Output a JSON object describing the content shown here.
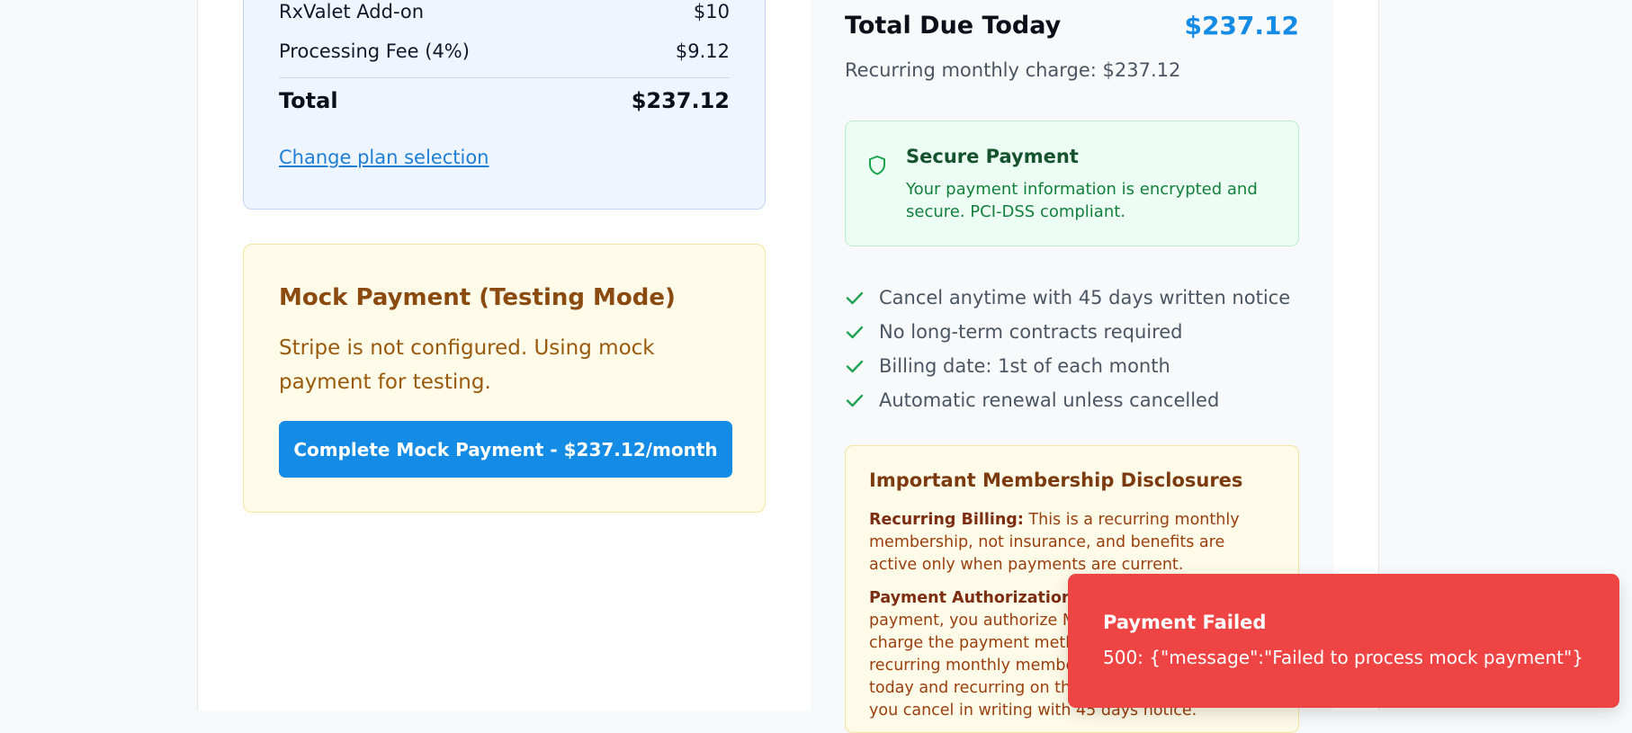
{
  "order_summary": {
    "addon_label": "RxValet Add-on",
    "addon_amount": "$10",
    "fee_label": "Processing Fee (4%)",
    "fee_amount": "$9.12",
    "total_label": "Total",
    "total_amount": "$237.12",
    "change_plan_link": "Change plan selection"
  },
  "mock_payment": {
    "title": "Mock Payment (Testing Mode)",
    "description": "Stripe is not configured. Using mock payment for testing.",
    "button_label": "Complete Mock Payment - $237.12/month"
  },
  "payment_panel": {
    "total_due_label": "Total Due Today",
    "total_due_amount": "$237.12",
    "recurring_text": "Recurring monthly charge: $237.12",
    "secure": {
      "icon": "shield-icon",
      "title": "Secure Payment",
      "description": "Your payment information is encrypted and secure. PCI-DSS compliant."
    },
    "benefits": [
      {
        "icon": "check-icon",
        "text": "Cancel anytime with 45 days written notice"
      },
      {
        "icon": "check-icon",
        "text": "No long-term contracts required"
      },
      {
        "icon": "check-icon",
        "text": "Billing date: 1st of each month"
      },
      {
        "icon": "check-icon",
        "text": "Automatic renewal unless cancelled"
      }
    ],
    "disclosures": {
      "title": "Important Membership Disclosures",
      "recurring_label": "Recurring Billing:",
      "recurring_text": " This is a recurring monthly membership, not insurance, and benefits are active only when payments are current.",
      "authorization_label": "Payment Authorization:",
      "authorization_text": " By completing this payment, you authorize My Premier Plans to charge the payment method on file for your recurring monthly membership fee beginning today and recurring on the 1st of each month until you cancel in writing with 45 days notice."
    }
  },
  "toast": {
    "title": "Payment Failed",
    "message": "500: {\"message\":\"Failed to process mock payment\"}"
  },
  "colors": {
    "accent": "#148be5",
    "error": "#ef4444",
    "success": "#15803d",
    "warning_text": "#9a5a0d"
  }
}
